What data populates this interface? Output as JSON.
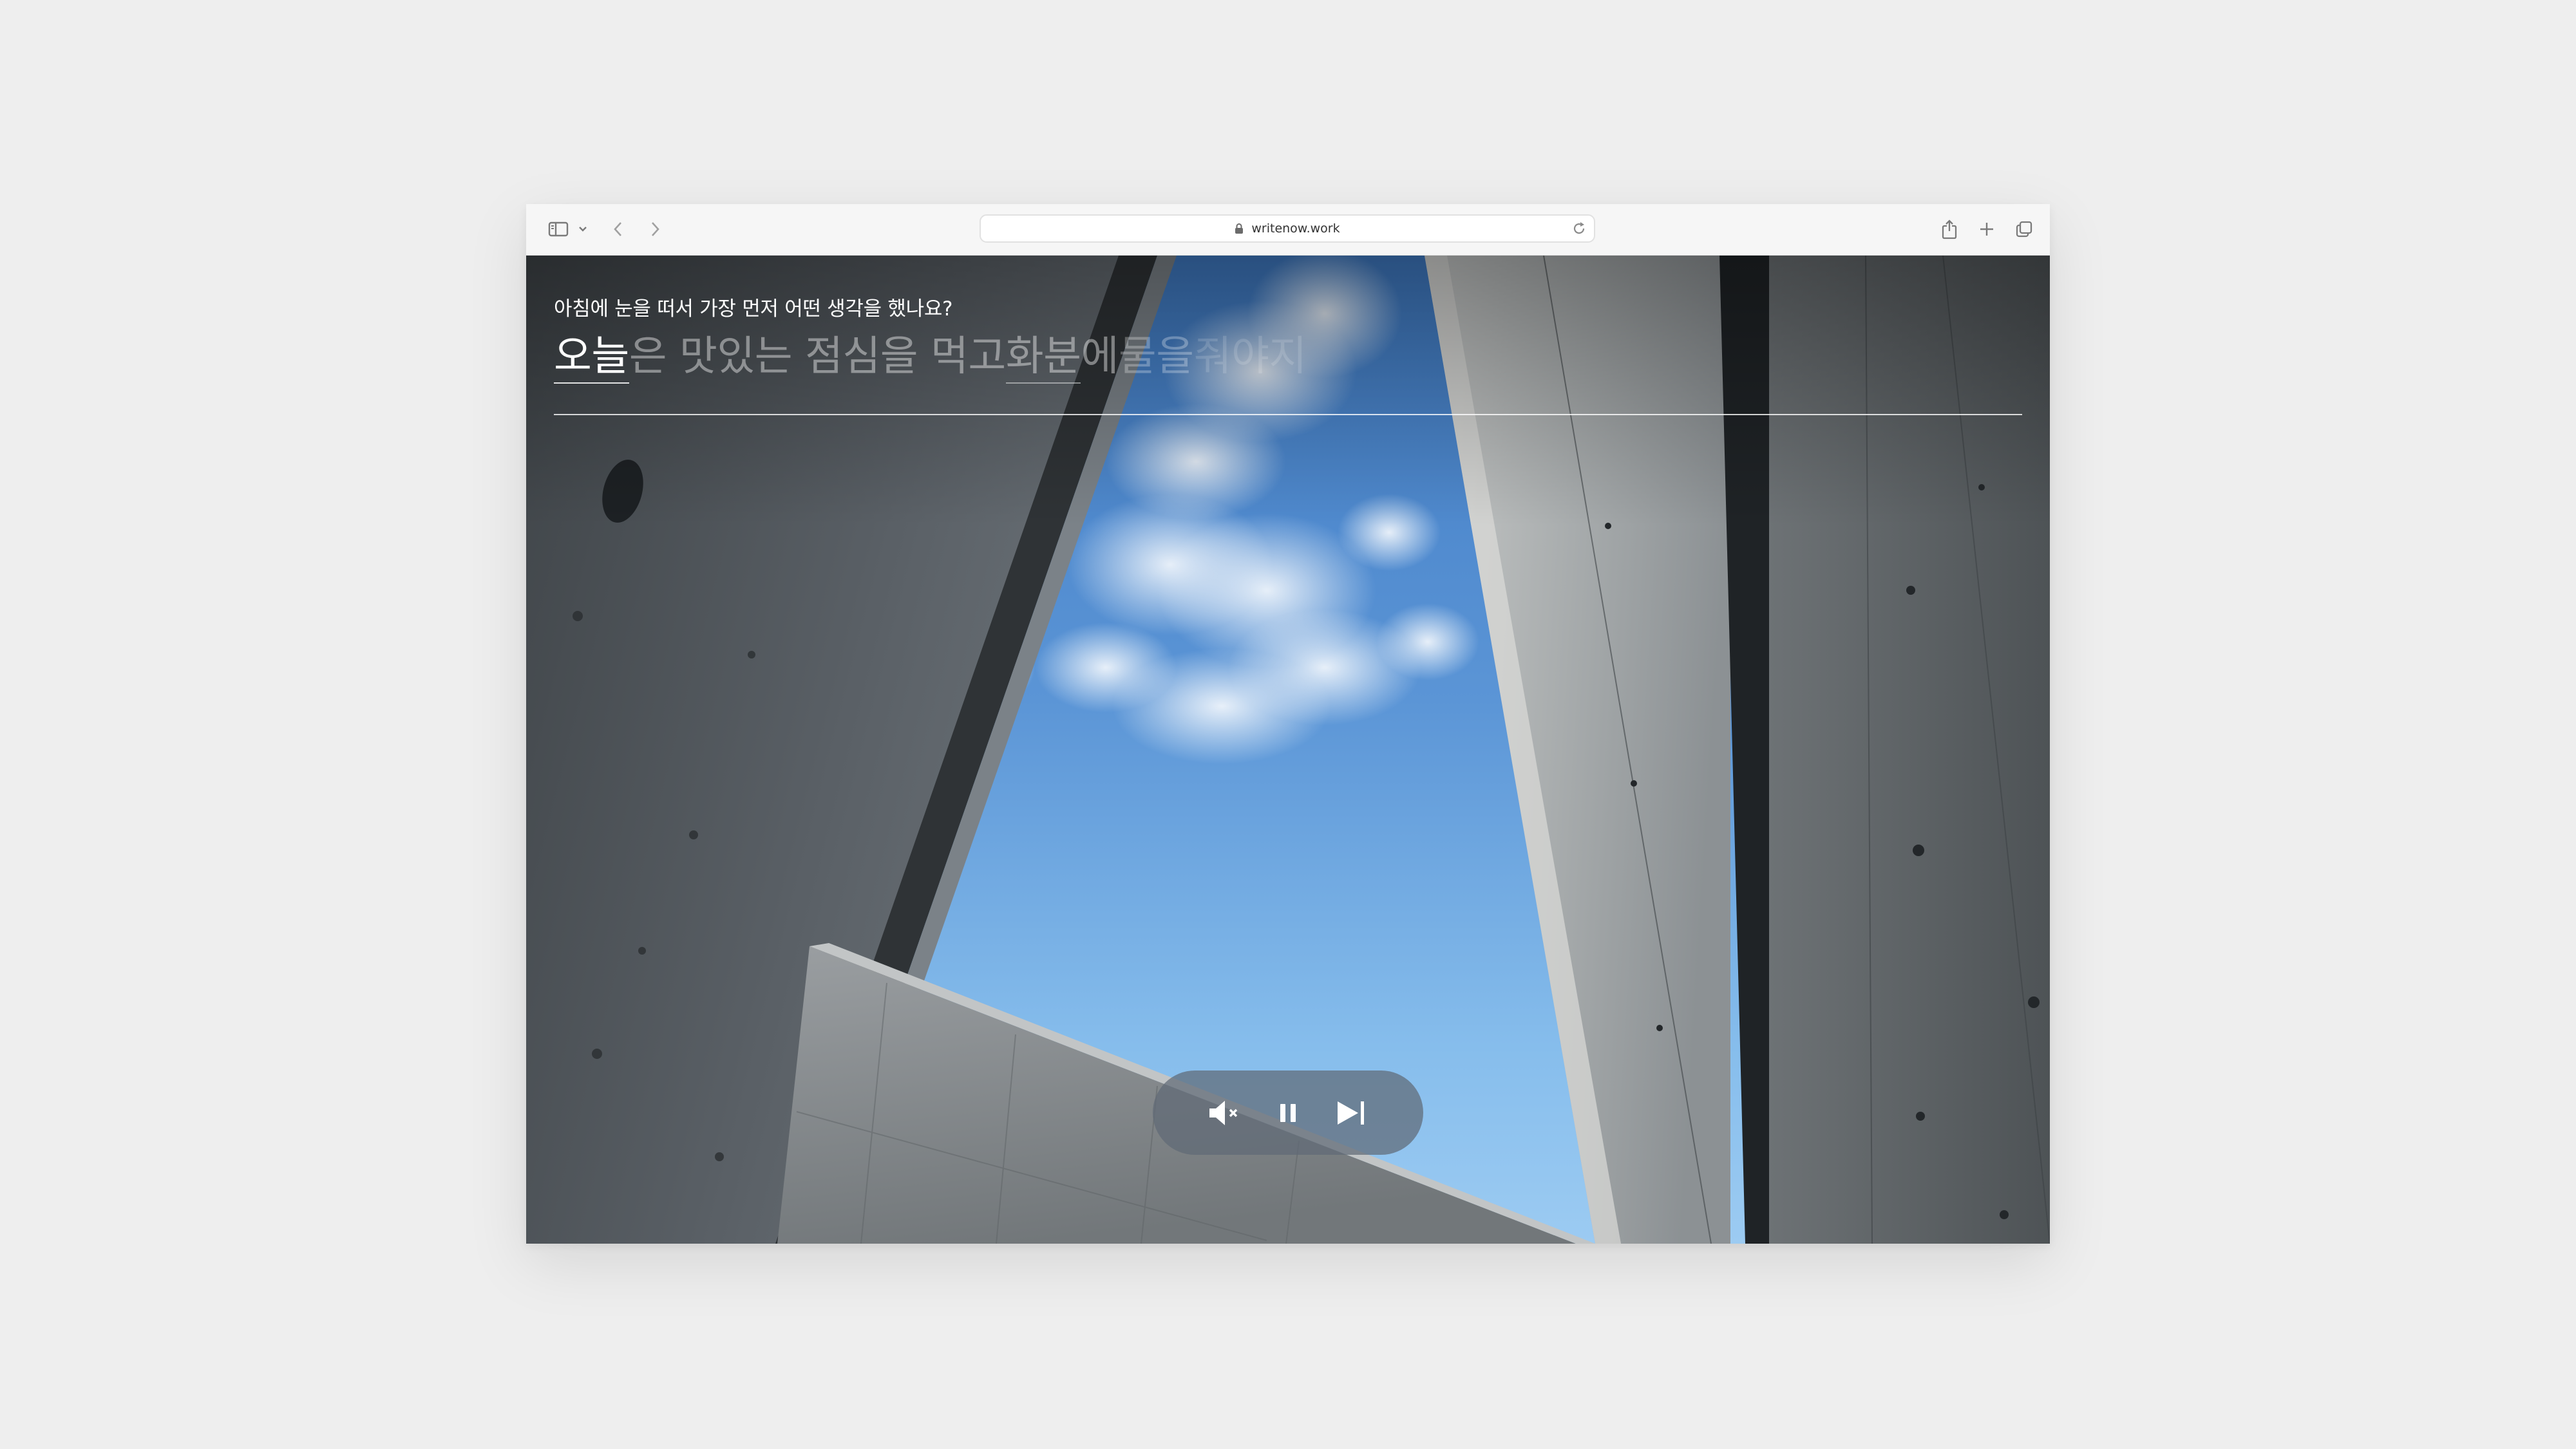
{
  "browser": {
    "url": "writenow.work",
    "icons": {
      "sidebar": "sidebar-icon",
      "sidebar_menu": "chevron-down-icon",
      "back": "chevron-left-icon",
      "forward": "chevron-right-icon",
      "lock": "lock-icon",
      "reload": "reload-icon",
      "share": "share-icon",
      "new_tab": "plus-icon",
      "tabs": "tab-overview-icon"
    }
  },
  "writing": {
    "question": "아침에 눈을 떠서 가장 먼저 어떤 생각을 했나요?",
    "typed": "오늘",
    "remaining_1": "은 맛있는 점심을 먹고 ",
    "remaining_marked": "화분",
    "remaining_2": "에 ",
    "fading_1": "물을",
    "fading_2": " 줘야지"
  },
  "player": {
    "mute_icon": "speaker-muted-icon",
    "pause_icon": "pause-icon",
    "next_icon": "skip-forward-icon"
  },
  "colors": {
    "page_background": "#eeeeee",
    "toolbar_background": "#f6f6f6",
    "control_pill": "#5f6976",
    "sky": "#6aa3dc"
  }
}
